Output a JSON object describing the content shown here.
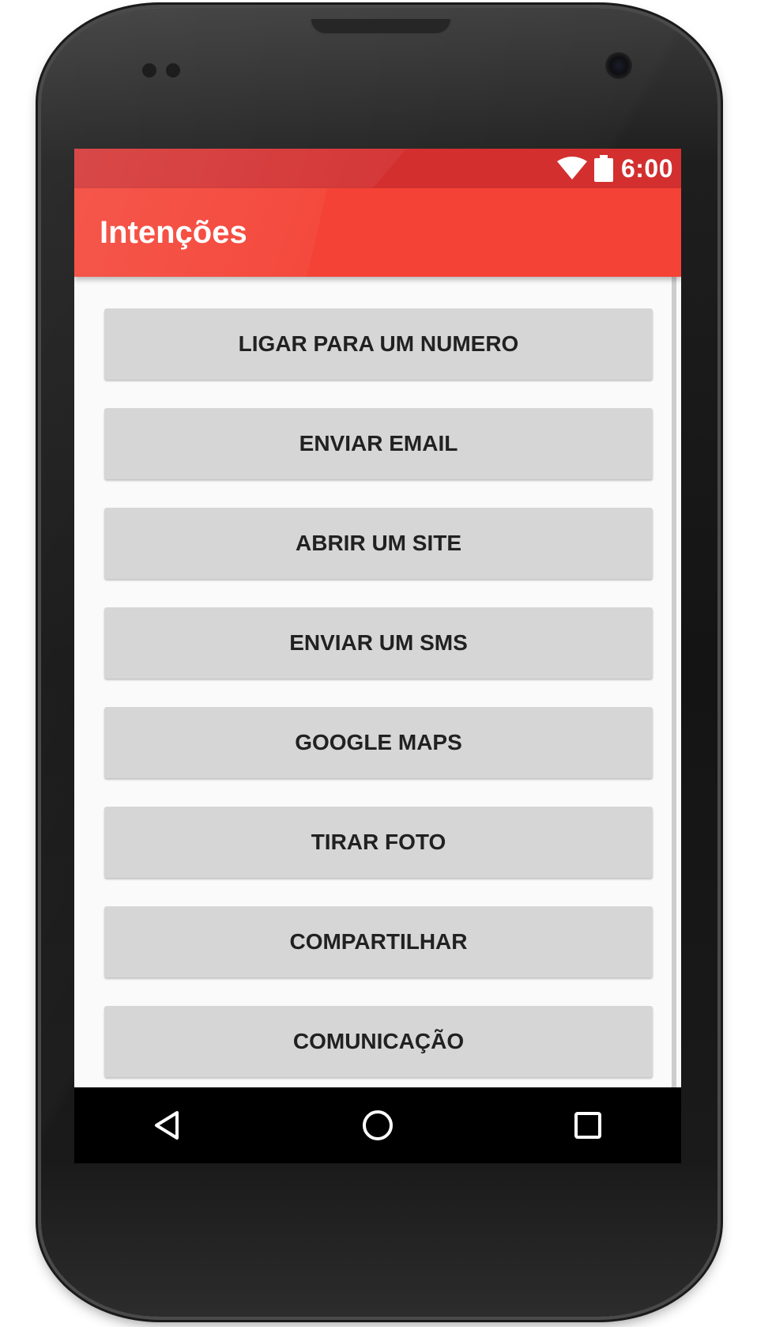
{
  "status_bar": {
    "time": "6:00",
    "icons": [
      "wifi-icon",
      "battery-icon"
    ]
  },
  "app_bar": {
    "title": "Intenções"
  },
  "buttons": [
    {
      "label": "LIGAR PARA UM NUMERO"
    },
    {
      "label": "ENVIAR EMAIL"
    },
    {
      "label": "ABRIR UM SITE"
    },
    {
      "label": "ENVIAR UM SMS"
    },
    {
      "label": "GOOGLE MAPS"
    },
    {
      "label": "TIRAR FOTO"
    },
    {
      "label": "COMPARTILHAR"
    },
    {
      "label": "COMUNICAÇÃO"
    }
  ],
  "nav_bar": {
    "icons": [
      "back-icon",
      "home-icon",
      "recents-icon"
    ]
  },
  "colors": {
    "status_bar": "#d32f2f",
    "app_bar": "#f44336",
    "background": "#fafafa",
    "button": "#d6d6d6",
    "button_text": "#212121"
  }
}
